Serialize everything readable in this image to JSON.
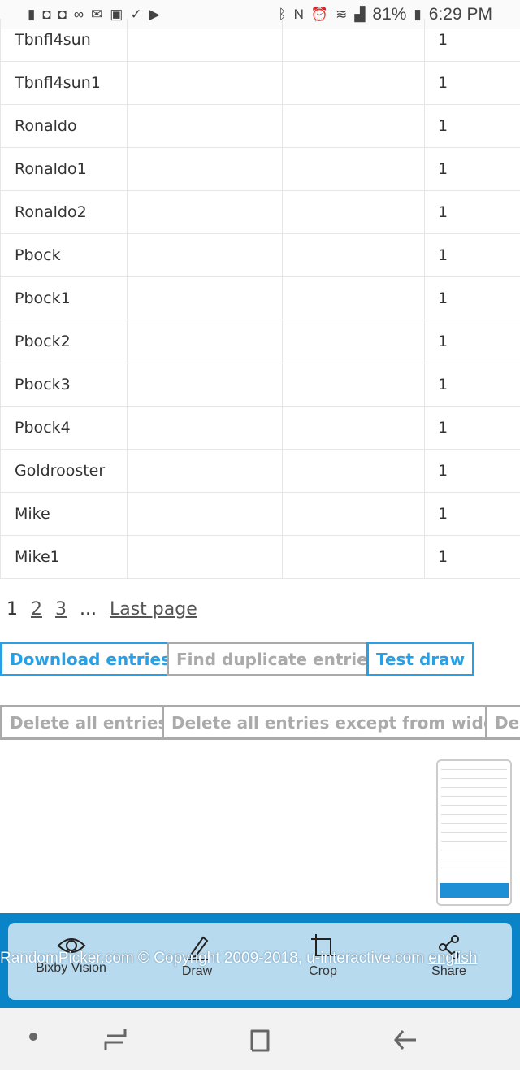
{
  "status_bar": {
    "battery": "81%",
    "time": "6:29 PM",
    "notification_icons": [
      "message-icon",
      "game-icon",
      "game-icon",
      "voicemail-icon",
      "email-icon",
      "image-icon",
      "task-icon",
      "youtube-icon"
    ],
    "system_icons": [
      "bluetooth-icon",
      "nfc-icon",
      "alarm-icon",
      "wifi-icon",
      "signal-icon",
      "battery-icon"
    ]
  },
  "table": {
    "rows": [
      {
        "name": "Tbnfl4sun",
        "count": "1"
      },
      {
        "name": "Tbnfl4sun1",
        "count": "1"
      },
      {
        "name": "Ronaldo",
        "count": "1"
      },
      {
        "name": "Ronaldo1",
        "count": "1"
      },
      {
        "name": "Ronaldo2",
        "count": "1"
      },
      {
        "name": "Pbock",
        "count": "1"
      },
      {
        "name": "Pbock1",
        "count": "1"
      },
      {
        "name": "Pbock2",
        "count": "1"
      },
      {
        "name": "Pbock3",
        "count": "1"
      },
      {
        "name": "Pbock4",
        "count": "1"
      },
      {
        "name": "Goldrooster",
        "count": "1"
      },
      {
        "name": "Mike",
        "count": "1"
      },
      {
        "name": "Mike1",
        "count": "1"
      }
    ]
  },
  "pagination": {
    "current": "1",
    "pages": [
      "2",
      "3"
    ],
    "ellipsis": "...",
    "last": "Last page"
  },
  "buttons": {
    "download": "Download entries",
    "find_duplicates": "Find duplicate entries",
    "test_draw": "Test draw",
    "delete_all": "Delete all entries",
    "delete_except_widget": "Delete all entries except from widget",
    "delete_cut": "Del"
  },
  "footer": {
    "copyright": "RandomPicker.com © Copyright 2009-2018, u-interactive.com",
    "language": "english"
  },
  "screenshot_toolbar": {
    "actions": [
      "Bixby Vision",
      "Draw",
      "Crop",
      "Share"
    ]
  },
  "colors": {
    "accent": "#29a0e6",
    "footer": "#0a84c9"
  }
}
